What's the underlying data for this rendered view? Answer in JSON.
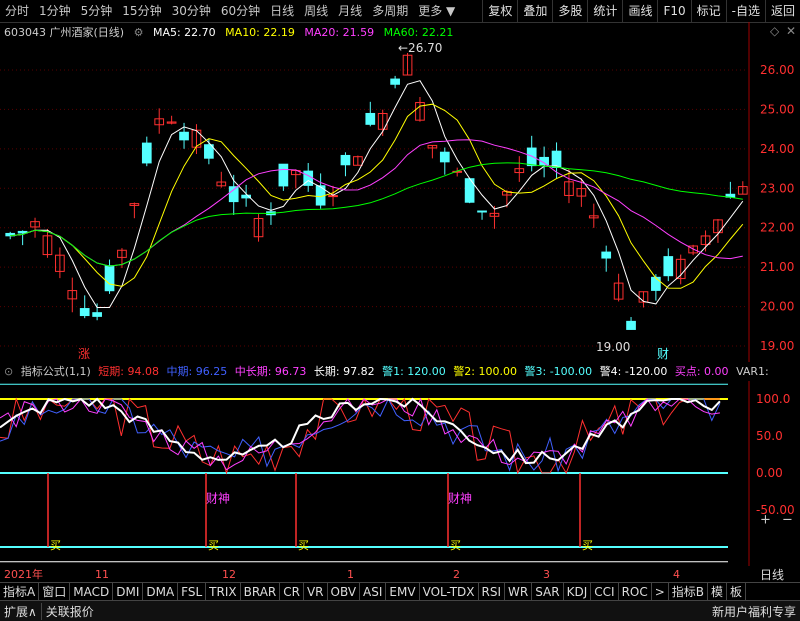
{
  "toolbar": {
    "periods": [
      "分时",
      "1分钟",
      "5分钟",
      "15分钟",
      "30分钟",
      "60分钟",
      "日线",
      "周线",
      "月线",
      "多周期",
      "更多"
    ],
    "buttons": [
      "复权",
      "叠加",
      "多股",
      "统计",
      "画线",
      "F10",
      "标记",
      "-自选",
      "返回"
    ]
  },
  "stock": {
    "code_name": "603043 广州酒家(日线)"
  },
  "ma": {
    "ma5": "MA5: 22.70",
    "ma10": "MA10: 22.19",
    "ma20": "MA20: 21.59",
    "ma60": "MA60: 22.21"
  },
  "price_labels": {
    "high": "26.70",
    "low": "19.00"
  },
  "price_axis": [
    "26.00",
    "25.00",
    "24.00",
    "23.00",
    "22.00",
    "21.00",
    "20.00",
    "19.00"
  ],
  "markers": {
    "zhang": "涨",
    "cai": "财",
    "caishen": "财神",
    "mai": "买"
  },
  "indicator": {
    "title": "指标公式(1,1)",
    "short": "短期: 94.08",
    "mid": "中期: 96.25",
    "midlong": "中长期: 96.73",
    "long": "长期: 97.82",
    "w1": "警1: 120.00",
    "w2": "警2: 100.00",
    "w3": "警3: -100.00",
    "w4": "警4: -120.00",
    "buy": "买点: 0.00",
    "var": "VAR1:"
  },
  "ind_axis": [
    "100.0",
    "50.0",
    "0.00",
    "-50.00"
  ],
  "dates": [
    "2021年",
    "11",
    "12",
    "1",
    "2",
    "3",
    "4"
  ],
  "date_right": "日线",
  "tabs": [
    "指标A",
    "窗口",
    "MACD",
    "DMI",
    "DMA",
    "FSL",
    "TRIX",
    "BRAR",
    "CR",
    "VR",
    "OBV",
    "ASI",
    "EMV",
    "VOL-TDX",
    "RSI",
    "WR",
    "SAR",
    "KDJ",
    "CCI",
    "ROC",
    ">",
    "指标B",
    "模",
    "板"
  ],
  "footer": {
    "left1": "扩展∧",
    "left2": "关联报价",
    "right": "新用户福利专享"
  },
  "colors": {
    "up": "#ff3030",
    "down": "#54ffff",
    "ma5": "#ffffff",
    "ma10": "#ffff00",
    "ma20": "#ff40ff",
    "ma60": "#00ff00"
  }
}
